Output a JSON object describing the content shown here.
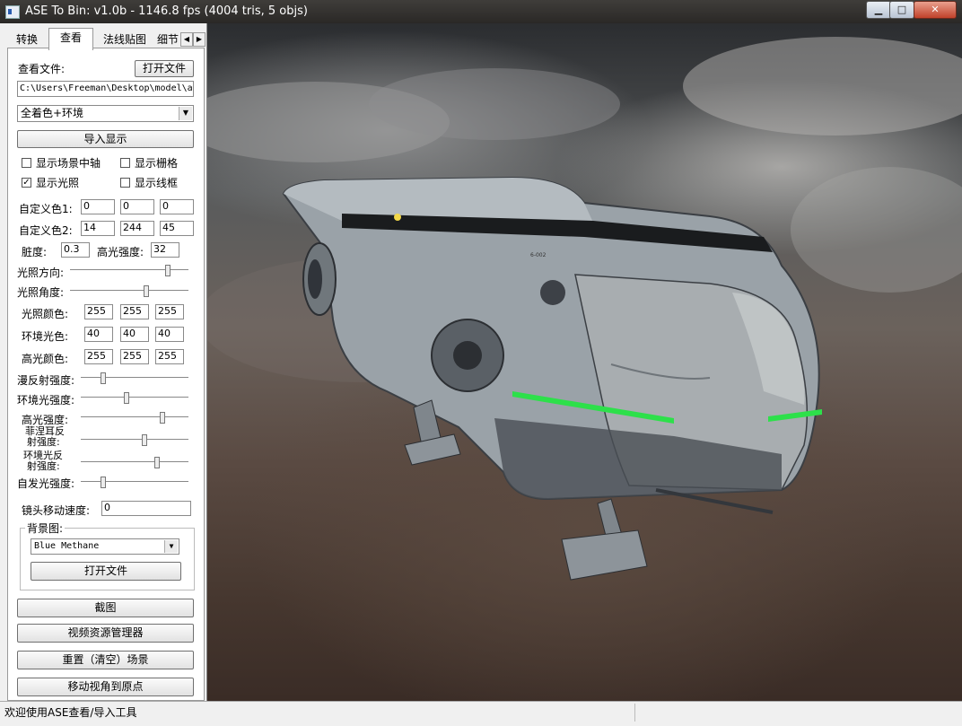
{
  "window": {
    "title": "ASE To Bin: v1.0b - 1146.8 fps (4004 tris, 5 objs)",
    "min_glyph": "▁",
    "max_glyph": "□",
    "close_glyph": "✕"
  },
  "tabs": [
    {
      "label": "转换"
    },
    {
      "label": "查看"
    },
    {
      "label": "法线贴图"
    },
    {
      "label": "细节"
    }
  ],
  "tab_scroll": {
    "left": "◀",
    "right": "▶"
  },
  "view": {
    "file_label": "查看文件:",
    "open_file_button": "打开文件",
    "file_path": "C:\\Users\\Freeman\\Desktop\\model\\a",
    "mode_select": "全着色+环境",
    "import_button": "导入显示",
    "checkboxes": [
      {
        "label": "显示场景中轴",
        "checked": false
      },
      {
        "label": "显示栅格",
        "checked": false
      },
      {
        "label": "显示光照",
        "checked": true
      },
      {
        "label": "显示线框",
        "checked": false
      }
    ],
    "check_mark": "✓",
    "custom_color1_label": "自定义色1:",
    "custom_color1": [
      "0",
      "0",
      "0"
    ],
    "custom_color2_label": "自定义色2:",
    "custom_color2": [
      "14",
      "244",
      "45"
    ],
    "dirt_label": "脏度:",
    "dirt_value": "0.3",
    "specular_label": "高光强度:",
    "specular_value": "32",
    "light_dir_label": "光照方向:",
    "light_dir_level": 0.82,
    "light_angle_label": "光照角度:",
    "light_angle_level": 0.64,
    "light_color_label": "光照颜色:",
    "light_color": [
      "255",
      "255",
      "255"
    ],
    "ambient_color_label": "环境光色:",
    "ambient_color": [
      "40",
      "40",
      "40"
    ],
    "spec_color_label": "高光颜色:",
    "spec_color": [
      "255",
      "255",
      "255"
    ],
    "diffuse_label": "漫反射强度:",
    "diffuse_level": 0.2,
    "ambient_int_label": "环境光强度:",
    "ambient_int_level": 0.42,
    "spec_int_label": "高光强度:",
    "spec_int_level": 0.75,
    "fresnel_label_1": "菲涅耳反",
    "fresnel_label_2": "射强度:",
    "fresnel_level": 0.58,
    "env_reflect_label_1": "环境光反",
    "env_reflect_label_2": "射强度:",
    "env_reflect_level": 0.7,
    "emissive_label": "自发光强度:",
    "emissive_level": 0.2,
    "camera_speed_label": "镜头移动速度:",
    "camera_speed": "0",
    "background_group": "背景图:",
    "background_select": "Blue Methane",
    "background_open": "打开文件",
    "screenshot_button": "截图",
    "video_manager_button": "视频资源管理器",
    "reset_button": "重置（清空）场景",
    "move_origin_button": "移动视角到原点"
  },
  "status": "欢迎使用ASE查看/导入工具",
  "ship_decal": "6-002",
  "colors": {
    "hull": "#9aa2a8",
    "hull_dark": "#4a4f55",
    "stripe": "#1a1c1e",
    "glow": "#2de04a",
    "light": "#f2d84a"
  }
}
